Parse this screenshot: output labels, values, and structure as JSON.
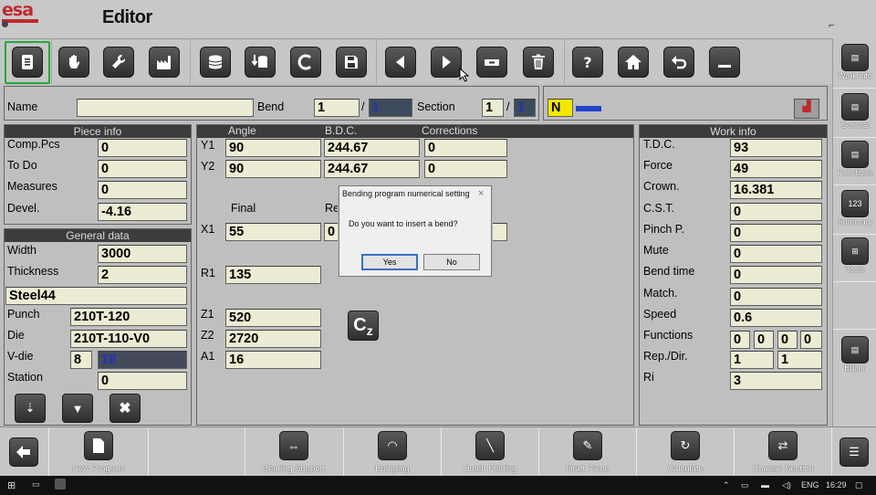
{
  "app": {
    "logo": "esa",
    "title": "Editor"
  },
  "header": {
    "name_label": "Name",
    "name_value": "",
    "bend_label": "Bend",
    "bend_value": "1",
    "bend_sep": "/",
    "bend_total": "1",
    "section_label": "Section",
    "section_value": "1",
    "section_sep": "/",
    "section_total": "1",
    "mode_value": "N"
  },
  "piece_info": {
    "title": "Piece info",
    "rows": [
      {
        "label": "Comp.Pcs",
        "value": "0"
      },
      {
        "label": "To Do",
        "value": "0"
      },
      {
        "label": "Measures",
        "value": "0"
      },
      {
        "label": "Devel.",
        "value": "-4.16"
      }
    ]
  },
  "general_data": {
    "title": "General data",
    "width_label": "Width",
    "width_value": "3000",
    "thickness_label": "Thickness",
    "thickness_value": "2",
    "material_value": "Steel44",
    "punch_label": "Punch",
    "punch_value": "210T-120",
    "die_label": "Die",
    "die_value": "210T-110-V0",
    "vdie_label": "V-die",
    "vdie_value_a": "8",
    "vdie_value_b": "18",
    "station_label": "Station",
    "station_value": "0"
  },
  "center": {
    "col_angle": "Angle",
    "col_bdc": "B.D.C.",
    "col_corrections": "Corrections",
    "y1_label": "Y1",
    "y1_angle": "90",
    "y1_bdc": "244.67",
    "y1_corr": "0",
    "y2_label": "Y2",
    "y2_angle": "90",
    "y2_bdc": "244.67",
    "y2_corr": "0",
    "final_label": "Final",
    "re_label": "Re",
    "x1_label": "X1",
    "x1_value": "55",
    "x1_value2": "0",
    "r1_label": "R1",
    "r1_value": "135",
    "z1_label": "Z1",
    "z1_value": "520",
    "z2_label": "Z2",
    "z2_value": "2720",
    "a1_label": "A1",
    "a1_value": "16",
    "cz_label": "C"
  },
  "work_info": {
    "title": "Work info",
    "tdc_label": "T.D.C.",
    "tdc_value": "93",
    "force_label": "Force",
    "force_value": "49",
    "crown_label": "Crown.",
    "crown_value": "16.381",
    "cst_label": "C.S.T.",
    "cst_value": "0",
    "pinch_label": "Pinch P.",
    "pinch_value": "0",
    "mute_label": "Mute",
    "mute_value": "0",
    "bendtime_label": "Bend time",
    "bendtime_value": "0",
    "match_label": "Match.",
    "match_value": "0",
    "speed_label": "Speed",
    "speed_value": "0.6",
    "functions_label": "Functions",
    "functions_values": [
      "0",
      "0",
      "0",
      "0"
    ],
    "repdir_label": "Rep./Dir.",
    "repdir_value_a": "1",
    "repdir_value_b": "1",
    "ri_label": "Ri",
    "ri_value": "3"
  },
  "dialog": {
    "title": "Bending program numerical setting",
    "close": "×",
    "message": "Do you want to insert a bend?",
    "yes": "Yes",
    "no": "No"
  },
  "right_menu": [
    "Work info",
    "General",
    "Functions",
    "Summary",
    "Tools",
    "Editor"
  ],
  "right_summary_num": "123",
  "bottom_menu": [
    "New Program",
    "Bearing Support",
    "Bumping",
    "Dutch Folding",
    "Draft Piece",
    "Calculate",
    "Change Section"
  ],
  "taskbar": {
    "lang": "ENG",
    "time": "16:29"
  }
}
